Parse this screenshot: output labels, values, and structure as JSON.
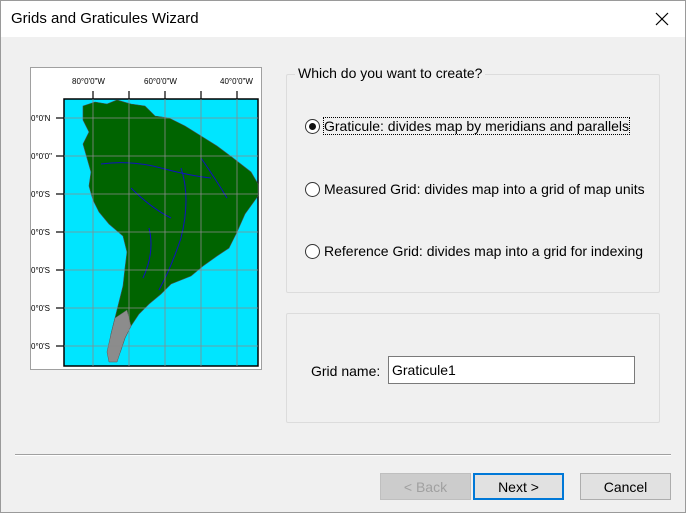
{
  "window": {
    "title": "Grids and Graticules Wizard",
    "close_icon": "close-icon"
  },
  "preview": {
    "longitude_labels": [
      "80°0'0\"W",
      "60°0'0\"W",
      "40°0'0\"W"
    ],
    "latitude_labels": [
      "0°0'N",
      "0°0'0\"",
      "0°0'S",
      "0°0'S",
      "0°0'S",
      "0°0'S",
      "0°0'S"
    ],
    "land_color": "#006400",
    "water_color": "#00e5ff",
    "river_color": "#1010c0",
    "gray_land_color": "#8c8c8c"
  },
  "choice_group": {
    "legend": "Which do you want to create?",
    "options": [
      {
        "label": "Graticule: divides map by meridians and parallels",
        "checked": true
      },
      {
        "label": "Measured Grid: divides map into a grid of map units",
        "checked": false
      },
      {
        "label": "Reference Grid: divides map into a grid for indexing",
        "checked": false
      }
    ]
  },
  "name_group": {
    "label": "Grid name:",
    "value": "Graticule1"
  },
  "buttons": {
    "back": "< Back",
    "next": "Next >",
    "cancel": "Cancel"
  }
}
